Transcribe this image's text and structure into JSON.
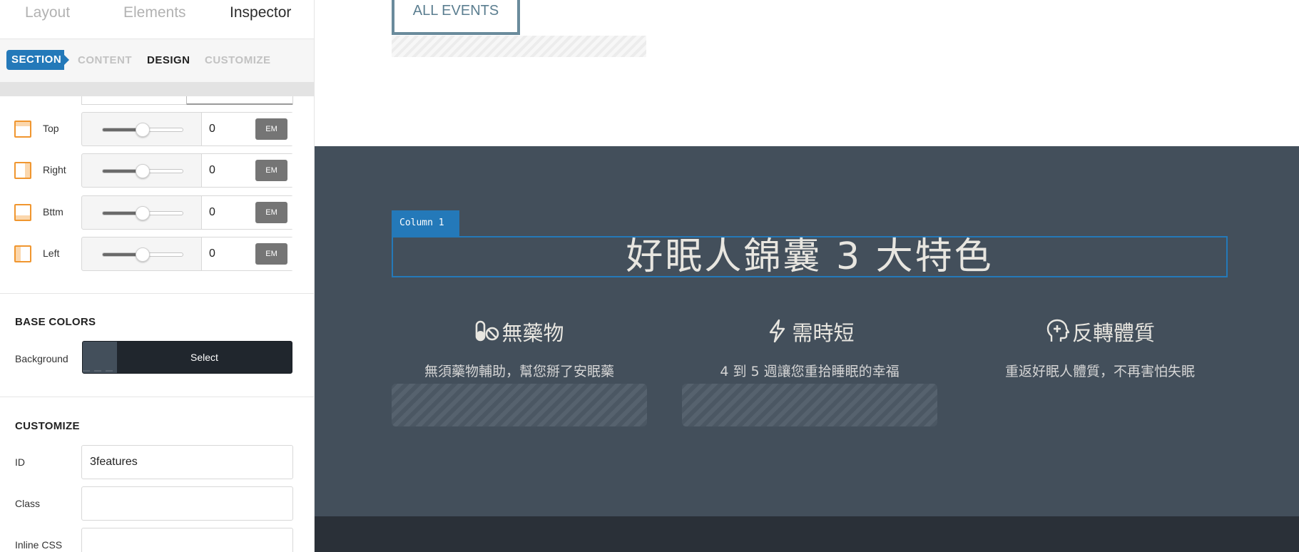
{
  "inspector": {
    "main_tabs": {
      "layout": "Layout",
      "elements": "Elements",
      "inspector": "Inspector"
    },
    "sub_tabs": {
      "section": "SECTION",
      "content": "CONTENT",
      "design": "DESIGN",
      "customize": "CUSTOMIZE"
    },
    "spacing": [
      {
        "label": "Top",
        "value": "0",
        "unit": "EM",
        "slider_fraction": 0.5
      },
      {
        "label": "Right",
        "value": "0",
        "unit": "EM",
        "slider_fraction": 0.5
      },
      {
        "label": "Bttm",
        "value": "0",
        "unit": "EM",
        "slider_fraction": 0.5
      },
      {
        "label": "Left",
        "value": "0",
        "unit": "EM",
        "slider_fraction": 0.5
      }
    ],
    "base_colors": {
      "heading": "BASE COLORS",
      "background_label": "Background",
      "background_color": "#434f5b",
      "select_label": "Select"
    },
    "customize": {
      "heading": "CUSTOMIZE",
      "id_label": "ID",
      "id_value": "3features",
      "class_label": "Class",
      "class_value": "",
      "inline_css_label": "Inline CSS",
      "inline_css_value": ""
    },
    "accent_color": "#2479b9",
    "icon_color": "#f0962f"
  },
  "canvas": {
    "all_events_button": "ALL EVENTS",
    "column_tag": "Column 1",
    "heading": "好眠人錦囊 3 大特色",
    "section_bg": "#434f5b",
    "features": [
      {
        "icon": "pills-slash-icon",
        "title": "無藥物",
        "desc": "無須藥物輔助，幫您掰了安眠藥"
      },
      {
        "icon": "bolt-icon",
        "title": "需時短",
        "desc": "4 到 5 週讓您重拾睡眠的幸福"
      },
      {
        "icon": "head-plus-icon",
        "title": "反轉體質",
        "desc": "重返好眠人體質，不再害怕失眠"
      }
    ]
  }
}
